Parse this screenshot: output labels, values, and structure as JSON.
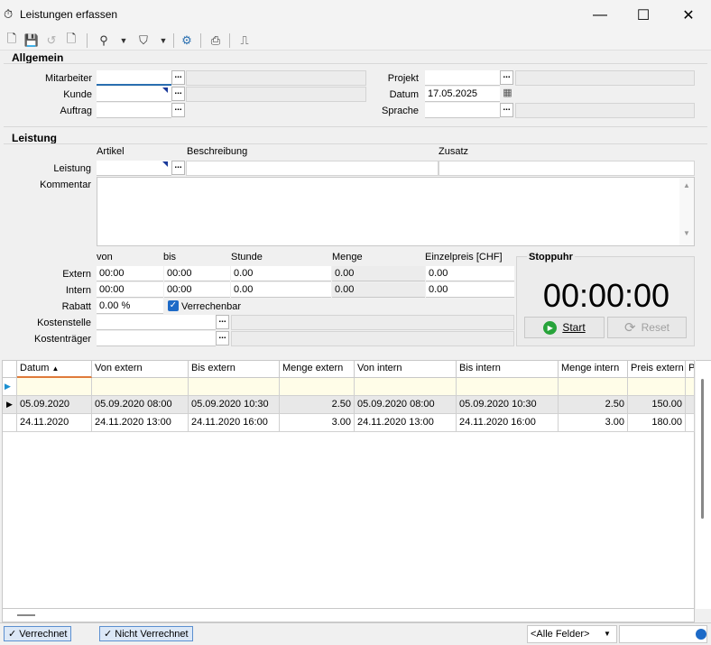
{
  "window": {
    "title": "Leistungen erfassen",
    "minimize": "—",
    "maximize": "☐",
    "close": "✕"
  },
  "toolbar": {
    "icons": [
      "new-document-icon",
      "save-icon",
      "undo-icon",
      "delete-document-icon",
      "pin-icon",
      "filter-icon",
      "settings-icon",
      "print-icon",
      "exit-icon"
    ]
  },
  "allgemein": {
    "title": "Allgemein",
    "mitarbeiter_label": "Mitarbeiter",
    "mitarbeiter_value": "",
    "kunde_label": "Kunde",
    "kunde_value": "",
    "auftrag_label": "Auftrag",
    "auftrag_value": "",
    "projekt_label": "Projekt",
    "projekt_value": "",
    "datum_label": "Datum",
    "datum_value": "17.05.2025",
    "sprache_label": "Sprache",
    "sprache_value": "",
    "dots": "..."
  },
  "leistung": {
    "title": "Leistung",
    "artikel_header": "Artikel",
    "beschreibung_header": "Beschreibung",
    "zusatz_header": "Zusatz",
    "leistung_label": "Leistung",
    "kommentar_label": "Kommentar",
    "col_von": "von",
    "col_bis": "bis",
    "col_stunde": "Stunde",
    "col_menge": "Menge",
    "col_einzelpreis": "Einzelpreis [CHF]",
    "extern_label": "Extern",
    "intern_label": "Intern",
    "extern": {
      "von": "00:00",
      "bis": "00:00",
      "stunde": "0.00",
      "menge": "0.00",
      "preis": "0.00"
    },
    "intern": {
      "von": "00:00",
      "bis": "00:00",
      "stunde": "0.00",
      "menge": "0.00",
      "preis": "0.00"
    },
    "rabatt_label": "Rabatt",
    "rabatt_value": "0.00 %",
    "verrechenbar_label": "Verrechenbar",
    "verrechenbar_checked": true,
    "kostenstelle_label": "Kostenstelle",
    "kostentraeger_label": "Kostenträger"
  },
  "stoppuhr": {
    "title": "Stoppuhr",
    "time": "00:00:00",
    "start_label": "Start",
    "reset_label": "Reset"
  },
  "grid": {
    "columns": [
      "Datum",
      "Von extern",
      "Bis extern",
      "Menge extern",
      "Von intern",
      "Bis intern",
      "Menge intern",
      "Preis extern",
      "P"
    ],
    "rows": [
      [
        "05.09.2020",
        "05.09.2020  08:00",
        "05.09.2020  10:30",
        "2.50",
        "05.09.2020  08:00",
        "05.09.2020  10:30",
        "2.50",
        "150.00",
        ""
      ],
      [
        "24.11.2020",
        "24.11.2020  13:00",
        "24.11.2020  16:00",
        "3.00",
        "24.11.2020  13:00",
        "24.11.2020  16:00",
        "3.00",
        "180.00",
        ""
      ]
    ]
  },
  "status": {
    "verrechnet": "Verrechnet",
    "nicht_verrechnet": "Nicht Verrechnet",
    "field_select": "<Alle Felder>"
  }
}
